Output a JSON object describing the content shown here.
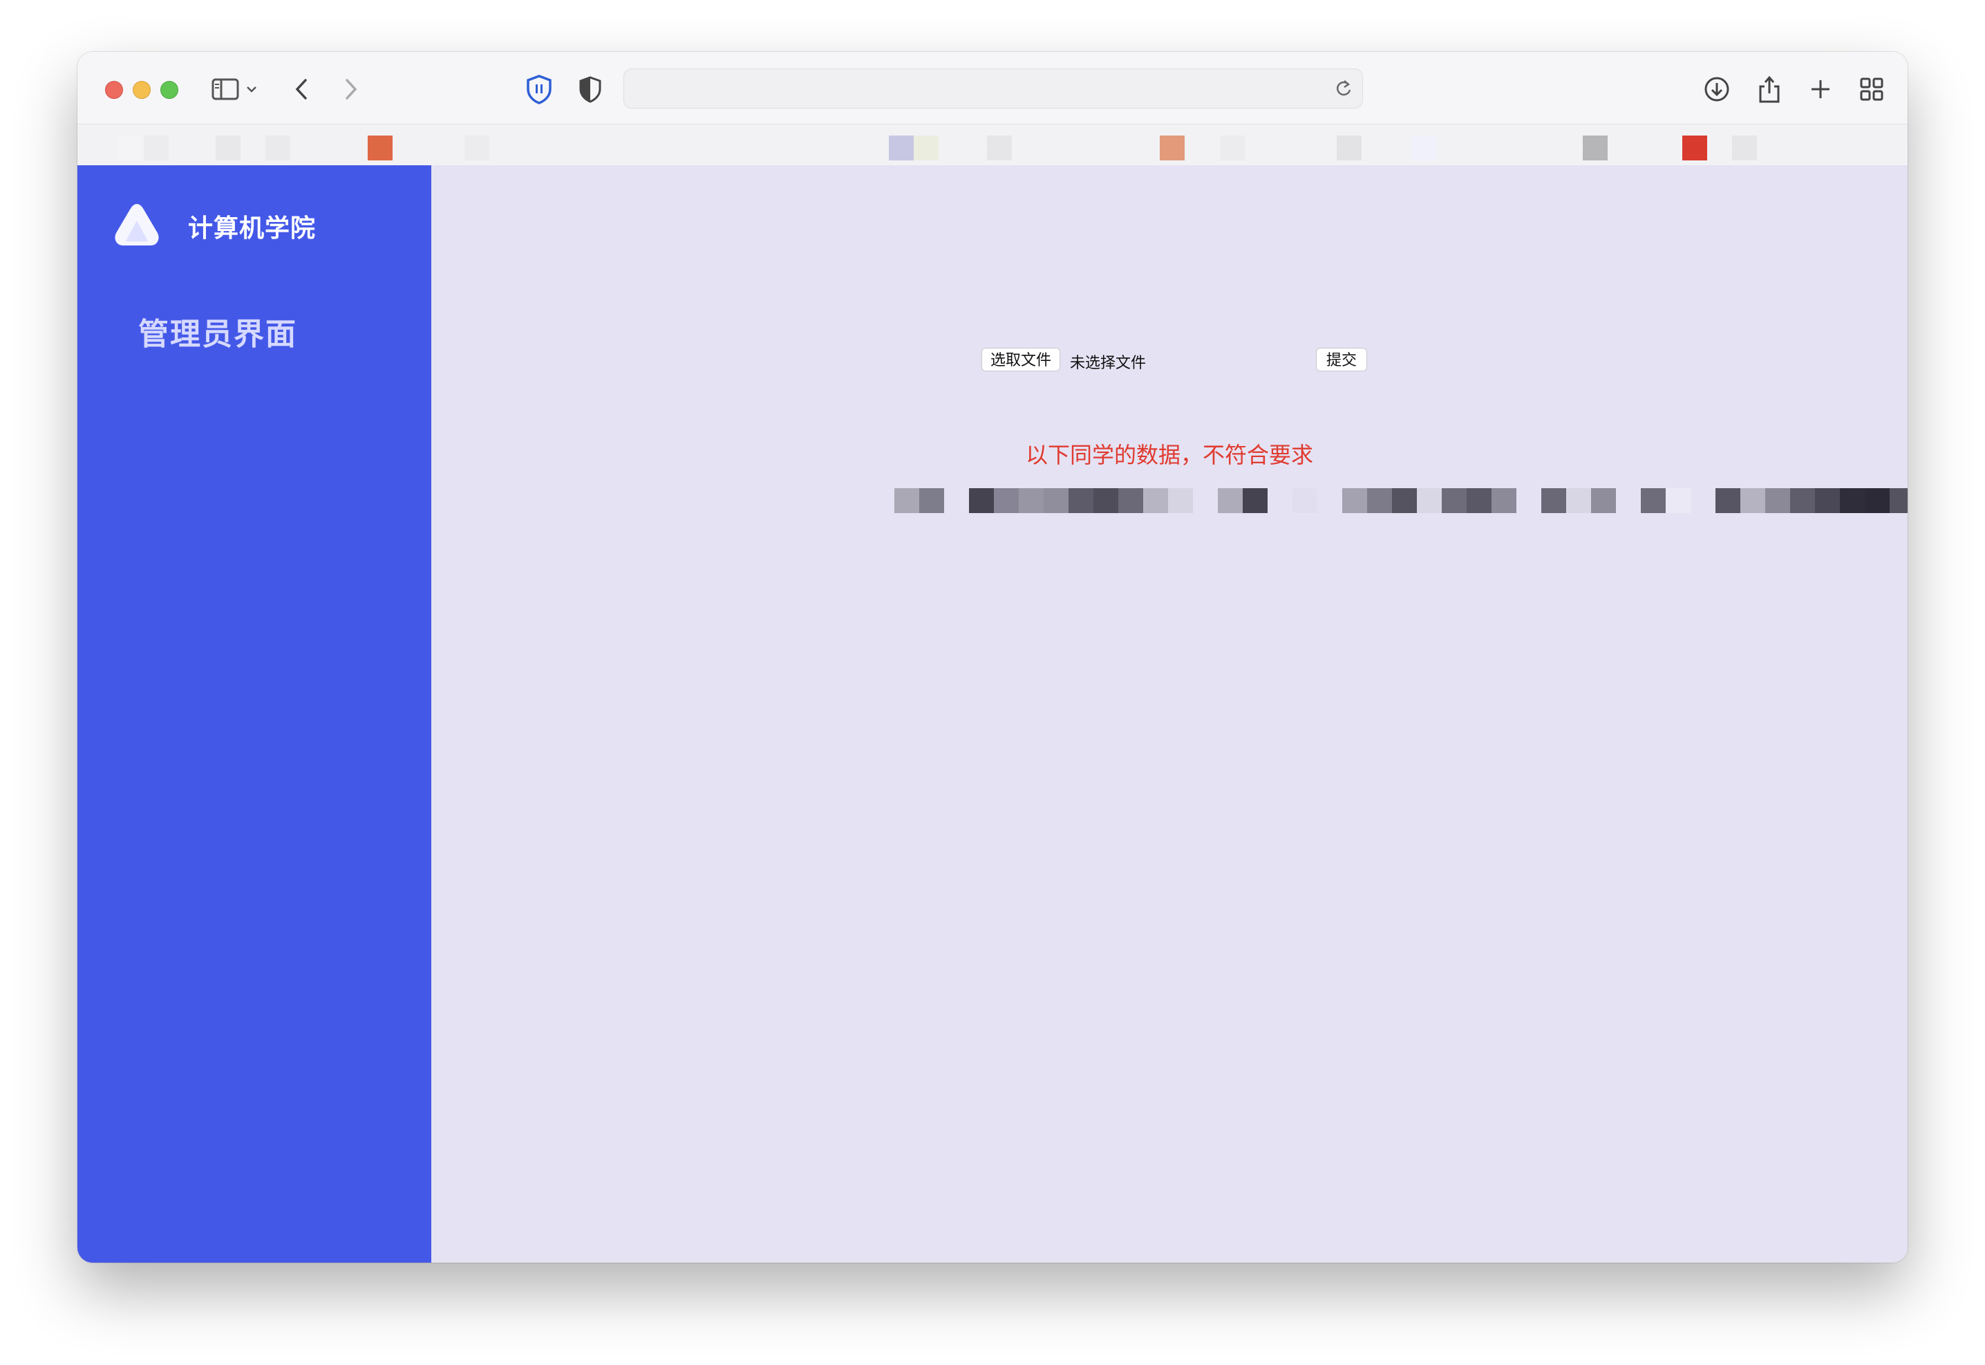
{
  "browser": {
    "icons": {
      "sidebar": "sidebar-toggle-icon",
      "chevron": "chevron-down-icon",
      "back": "back-arrow-icon",
      "forward": "forward-arrow-icon",
      "privacy": "privacy-shield-icon",
      "shield": "half-shield-icon",
      "reload": "reload-icon",
      "download": "download-icon",
      "share": "share-icon",
      "new_tab": "plus-icon",
      "tab_overview": "grid-icon"
    },
    "address_value": ""
  },
  "sidebar": {
    "brand": "计算机学院",
    "section_title": "管理员界面",
    "color": "#4458e8"
  },
  "upload": {
    "choose_file_label": "选取文件",
    "file_status": "未选择文件",
    "submit_label": "提交"
  },
  "result": {
    "warning": "以下同学的数据，不符合要求",
    "warning_color": "#e03a2f"
  },
  "colors": {
    "content_bg": "#e5e2f3",
    "accent": "#4458e8"
  }
}
